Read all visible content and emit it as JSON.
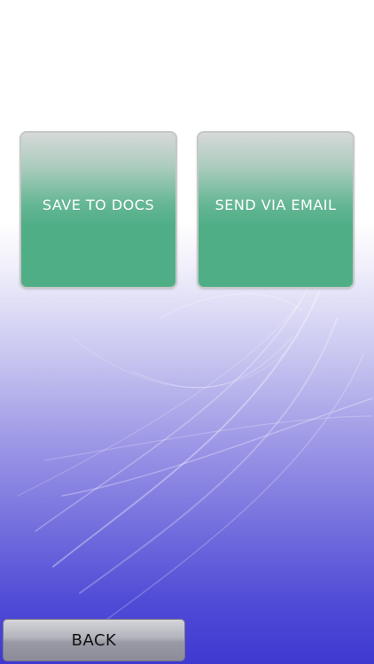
{
  "actions": {
    "save_label": "SAVE TO DOCS",
    "email_label": "SEND VIA EMAIL"
  },
  "navigation": {
    "back_label": "BACK"
  },
  "colors": {
    "tile_green": "#4fae86",
    "background_top": "#ffffff",
    "background_bottom": "#3f39d2",
    "back_button_gray": "#9a9aa6"
  }
}
